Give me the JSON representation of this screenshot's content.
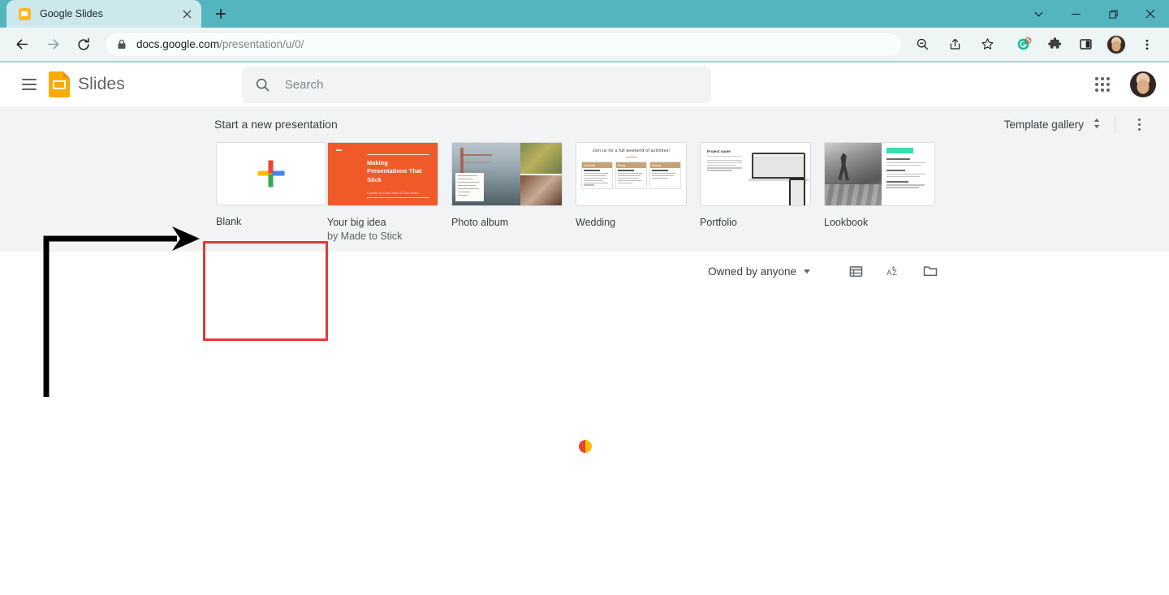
{
  "browser": {
    "tab": {
      "title": "Google Slides",
      "favicon": "slides-favicon",
      "close": "×"
    },
    "new_tab_label": "+",
    "window_controls": {
      "minimize": "—",
      "maximize": "❐",
      "close": "✕",
      "tab_search": "⌄"
    },
    "nav": {
      "back": "←",
      "forward": "→",
      "reload": "⟳"
    },
    "omnibox": {
      "lock_icon": "lock-icon",
      "url_host": "docs.google.com",
      "url_path": "/presentation/u/0/",
      "full_url": "docs.google.com/presentation/u/0/"
    },
    "omni_actions": [
      "zoom-out-icon",
      "share-icon",
      "bookmark-star-icon"
    ],
    "extensions": [
      "grammarly-icon",
      "puzzle-extensions-icon",
      "side-panel-icon",
      "profile-avatar",
      "chrome-menu-icon"
    ],
    "theme_color": "#55B5BF"
  },
  "app": {
    "menu_label": "Main menu",
    "product_name": "Slides",
    "search": {
      "placeholder": "Search",
      "value": "",
      "icon": "search-icon"
    },
    "apps_launcher": "google-apps-icon",
    "account_avatar": "account-avatar"
  },
  "templates": {
    "section_title": "Start a new presentation",
    "gallery_label": "Template gallery",
    "gallery_toggle_icon": "unfold-more-icon",
    "more_icon": "more-options-icon",
    "cards": [
      {
        "label": "Blank",
        "sub": "",
        "thumb": "blank-plus-thumbnail",
        "highlighted": true
      },
      {
        "label": "Your big idea",
        "sub": "by Made to Stick",
        "thumb": "your-big-idea-thumbnail",
        "thumb_text": {
          "heading": "Making Presentations That Stick",
          "byline": "A guide by Chip Heath & Dan Heath"
        }
      },
      {
        "label": "Photo album",
        "sub": "",
        "thumb": "photo-album-thumbnail"
      },
      {
        "label": "Wedding",
        "sub": "",
        "thumb": "wedding-thumbnail",
        "thumb_text": {
          "heading": "Join us for a full weekend of activities!",
          "columns": [
            "Thursday",
            "Friday",
            "Sunday"
          ]
        }
      },
      {
        "label": "Portfolio",
        "sub": "",
        "thumb": "portfolio-thumbnail",
        "thumb_text": {
          "heading": "Project name"
        }
      },
      {
        "label": "Lookbook",
        "sub": "",
        "thumb": "lookbook-thumbnail"
      }
    ]
  },
  "filters": {
    "owner_label": "Owned by anyone",
    "list_view_icon": "list-view-icon",
    "sort_icon": "sort-az-icon",
    "folder_icon": "file-picker-folder-icon"
  },
  "status": {
    "loading_spinner": "loading-spinner"
  },
  "annotation": {
    "arrow": "pointer-arrow-to-blank-card",
    "color": "#000000",
    "highlight_color": "#E53935"
  }
}
